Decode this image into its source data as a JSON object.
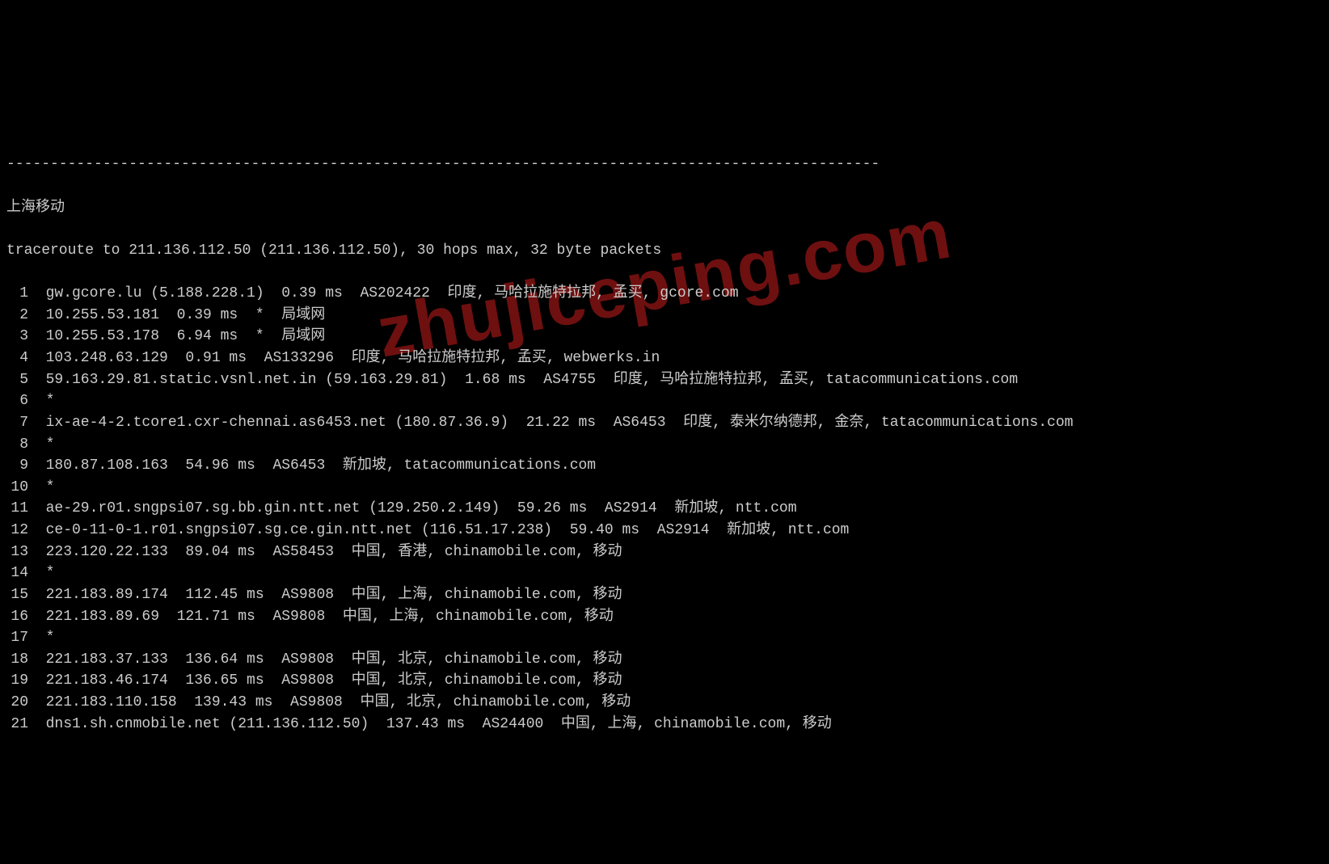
{
  "separator": "----------------------------------------------------------------------------------------------------",
  "location_header": "上海移动",
  "traceroute_header": "traceroute to 211.136.112.50 (211.136.112.50), 30 hops max, 32 byte packets",
  "watermark_text": "zhujiceping.com",
  "hops": [
    {
      "num": " 1",
      "text": "gw.gcore.lu (5.188.228.1)  0.39 ms  AS202422  印度, 马哈拉施特拉邦, 孟买, gcore.com"
    },
    {
      "num": " 2",
      "text": "10.255.53.181  0.39 ms  *  局域网"
    },
    {
      "num": " 3",
      "text": "10.255.53.178  6.94 ms  *  局域网"
    },
    {
      "num": " 4",
      "text": "103.248.63.129  0.91 ms  AS133296  印度, 马哈拉施特拉邦, 孟买, webwerks.in"
    },
    {
      "num": " 5",
      "text": "59.163.29.81.static.vsnl.net.in (59.163.29.81)  1.68 ms  AS4755  印度, 马哈拉施特拉邦, 孟买, tatacommunications.com"
    },
    {
      "num": " 6",
      "text": "*"
    },
    {
      "num": " 7",
      "text": "ix-ae-4-2.tcore1.cxr-chennai.as6453.net (180.87.36.9)  21.22 ms  AS6453  印度, 泰米尔纳德邦, 金奈, tatacommunications.com"
    },
    {
      "num": " 8",
      "text": "*"
    },
    {
      "num": " 9",
      "text": "180.87.108.163  54.96 ms  AS6453  新加坡, tatacommunications.com"
    },
    {
      "num": "10",
      "text": "*"
    },
    {
      "num": "11",
      "text": "ae-29.r01.sngpsi07.sg.bb.gin.ntt.net (129.250.2.149)  59.26 ms  AS2914  新加坡, ntt.com"
    },
    {
      "num": "12",
      "text": "ce-0-11-0-1.r01.sngpsi07.sg.ce.gin.ntt.net (116.51.17.238)  59.40 ms  AS2914  新加坡, ntt.com"
    },
    {
      "num": "13",
      "text": "223.120.22.133  89.04 ms  AS58453  中国, 香港, chinamobile.com, 移动"
    },
    {
      "num": "14",
      "text": "*"
    },
    {
      "num": "15",
      "text": "221.183.89.174  112.45 ms  AS9808  中国, 上海, chinamobile.com, 移动"
    },
    {
      "num": "16",
      "text": "221.183.89.69  121.71 ms  AS9808  中国, 上海, chinamobile.com, 移动"
    },
    {
      "num": "17",
      "text": "*"
    },
    {
      "num": "18",
      "text": "221.183.37.133  136.64 ms  AS9808  中国, 北京, chinamobile.com, 移动"
    },
    {
      "num": "19",
      "text": "221.183.46.174  136.65 ms  AS9808  中国, 北京, chinamobile.com, 移动"
    },
    {
      "num": "20",
      "text": "221.183.110.158  139.43 ms  AS9808  中国, 北京, chinamobile.com, 移动"
    },
    {
      "num": "21",
      "text": "dns1.sh.cnmobile.net (211.136.112.50)  137.43 ms  AS24400  中国, 上海, chinamobile.com, 移动"
    }
  ]
}
